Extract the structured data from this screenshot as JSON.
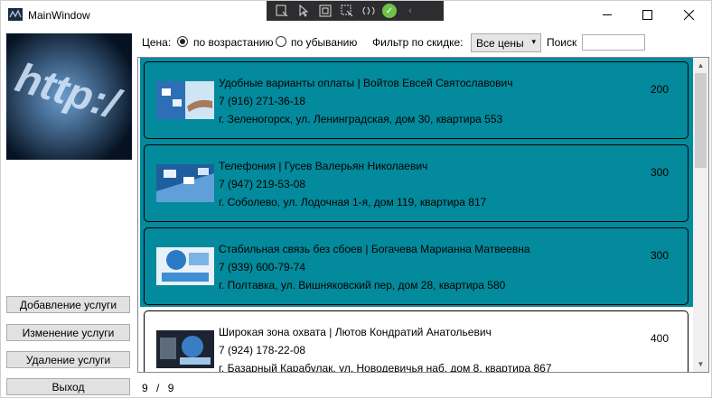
{
  "window": {
    "title": "MainWindow"
  },
  "debug_toolbar": {
    "icons": [
      "select-element-icon",
      "pointer-icon",
      "layout-adorner-icon",
      "track-focus-icon",
      "hot-reload-icon",
      "check-ok-icon",
      "collapse-chevron-icon"
    ]
  },
  "filters": {
    "price_label": "Цена:",
    "ascending_label": "по возрастанию",
    "descending_label": "по убыванию",
    "ascending_selected": true,
    "discount_label": "Фильтр по скидке:",
    "discount_value": "Все цены",
    "search_label": "Поиск",
    "search_value": ""
  },
  "sidebar": {
    "add_label": "Добавление услуги",
    "edit_label": "Изменение услуги",
    "delete_label": "Удаление услуги",
    "exit_label": "Выход"
  },
  "services": [
    {
      "title": "Удобные варианты оплаты | Войтов Евсей Святославович",
      "phone": "7 (916) 271-36-18",
      "address": "г. Зеленогорск, ул. Ленинградская, дом 30, квартира 553",
      "price": "200",
      "highlighted": true
    },
    {
      "title": "Телефония | Гусев Валерьян Николаевич",
      "phone": "7 (947) 219-53-08",
      "address": "г. Соболево, ул. Лодочная 1-я, дом 119, квартира 817",
      "price": "300",
      "highlighted": true
    },
    {
      "title": "Стабильная связь без сбоев | Богачева Марианна Матвеевна",
      "phone": "7 (939) 600-79-74",
      "address": " г. Полтавка, ул. Вишняковский пер, дом 28, квартира 580",
      "price": "300",
      "highlighted": true
    },
    {
      "title": "Широкая зона охвата | Лютов Кондратий Анатольевич",
      "phone": "7 (924) 178-22-08",
      "address": "г. Базарный Карабулак, ул. Новодевичья наб, дом 8, квартира 867",
      "price": "400",
      "highlighted": false
    }
  ],
  "pager": {
    "shown": "9",
    "separator": "/",
    "total": "9"
  },
  "colors": {
    "highlight": "#038a9c",
    "debug_bar": "#2d2d30"
  }
}
